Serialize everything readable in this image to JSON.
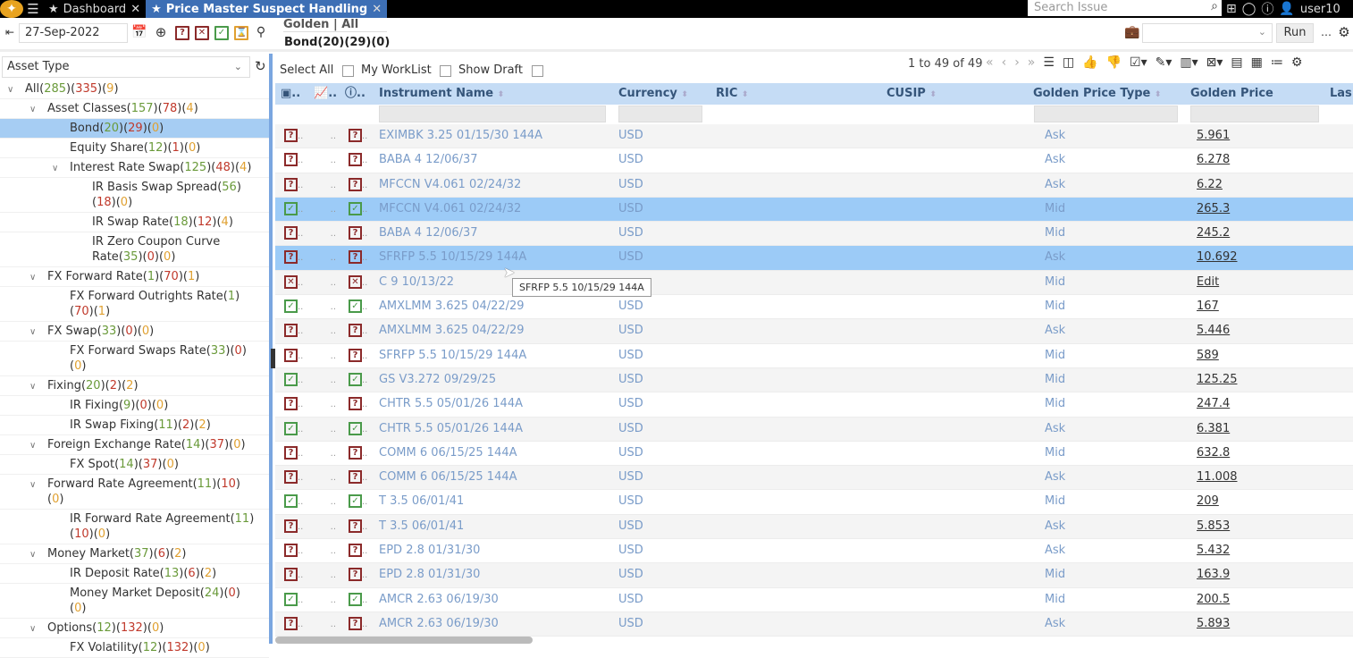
{
  "topbar": {
    "tabs": [
      {
        "label": "Dashboard",
        "active": false
      },
      {
        "label": "Price Master Suspect Handling",
        "active": true
      }
    ],
    "search_placeholder": "Search Issue",
    "user": "user10"
  },
  "toolbar": {
    "date": "27-Sep-2022",
    "breadcrumb": "Golden | All",
    "selection": "Bond(20)(29)(0)",
    "run_label": "Run",
    "run_select": ""
  },
  "left": {
    "asset_type": "Asset Type",
    "tree": [
      {
        "name": "All",
        "c": [
          "285",
          "335",
          "9"
        ],
        "level": 0,
        "expanded": true
      },
      {
        "name": "Asset Classes",
        "c": [
          "157",
          "78",
          "4"
        ],
        "level": 1,
        "expanded": true
      },
      {
        "name": "Bond",
        "c": [
          "20",
          "29",
          "0"
        ],
        "level": 2,
        "selected": true
      },
      {
        "name": "Equity Share",
        "c": [
          "12",
          "1",
          "0"
        ],
        "level": 2
      },
      {
        "name": "Interest Rate Swap",
        "c": [
          "125",
          "48",
          "4"
        ],
        "level": 2,
        "expanded": true
      },
      {
        "name": "IR Basis Swap Spread",
        "c": [
          "56",
          "18",
          "0"
        ],
        "level": 3
      },
      {
        "name": "IR Swap Rate",
        "c": [
          "18",
          "12",
          "4"
        ],
        "level": 3
      },
      {
        "name": "IR Zero Coupon Curve Rate",
        "c": [
          "35",
          "0",
          "0"
        ],
        "level": 3
      },
      {
        "name": "FX Forward Rate",
        "c": [
          "1",
          "70",
          "1"
        ],
        "level": 1,
        "expanded": true
      },
      {
        "name": "FX Forward Outrights Rate",
        "c": [
          "1",
          "70",
          "1"
        ],
        "level": 2
      },
      {
        "name": "FX Swap",
        "c": [
          "33",
          "0",
          "0"
        ],
        "level": 1,
        "expanded": true
      },
      {
        "name": "FX Forward Swaps Rate",
        "c": [
          "33",
          "0",
          "0"
        ],
        "level": 2
      },
      {
        "name": "Fixing",
        "c": [
          "20",
          "2",
          "2"
        ],
        "level": 1,
        "expanded": true
      },
      {
        "name": "IR Fixing",
        "c": [
          "9",
          "0",
          "0"
        ],
        "level": 2
      },
      {
        "name": "IR Swap Fixing",
        "c": [
          "11",
          "2",
          "2"
        ],
        "level": 2
      },
      {
        "name": "Foreign Exchange Rate",
        "c": [
          "14",
          "37",
          "0"
        ],
        "level": 1,
        "expanded": true
      },
      {
        "name": "FX Spot",
        "c": [
          "14",
          "37",
          "0"
        ],
        "level": 2
      },
      {
        "name": "Forward Rate Agreement",
        "c": [
          "11",
          "10",
          "0"
        ],
        "level": 1,
        "expanded": true
      },
      {
        "name": "IR Forward Rate Agreement",
        "c": [
          "11",
          "10",
          "0"
        ],
        "level": 2
      },
      {
        "name": "Money Market",
        "c": [
          "37",
          "6",
          "2"
        ],
        "level": 1,
        "expanded": true
      },
      {
        "name": "IR Deposit Rate",
        "c": [
          "13",
          "6",
          "2"
        ],
        "level": 2
      },
      {
        "name": "Money Market Deposit",
        "c": [
          "24",
          "0",
          "0"
        ],
        "level": 2
      },
      {
        "name": "Options",
        "c": [
          "12",
          "132",
          "0"
        ],
        "level": 1,
        "expanded": true
      },
      {
        "name": "FX Volatility",
        "c": [
          "12",
          "132",
          "0"
        ],
        "level": 2
      }
    ]
  },
  "grid": {
    "select_all": "Select All",
    "my_worklist": "My WorkList",
    "show_draft": "Show Draft",
    "pager": "1 to 49 of 49",
    "columns": [
      "Instrument Name",
      "Currency",
      "RIC",
      "CUSIP",
      "Golden Price Type",
      "Golden Price",
      "Las"
    ],
    "tooltip": "SFRFP 5.5 10/15/29 144A",
    "rows": [
      {
        "s": "q",
        "name": "EXIMBK 3.25 01/15/30 144A",
        "cur": "USD",
        "type": "Ask",
        "price": "5.961"
      },
      {
        "s": "q",
        "name": "BABA 4 12/06/37",
        "cur": "USD",
        "type": "Ask",
        "price": "6.278"
      },
      {
        "s": "q",
        "name": "MFCCN V4.061 02/24/32",
        "cur": "USD",
        "type": "Ask",
        "price": "6.22"
      },
      {
        "s": "c",
        "name": "MFCCN V4.061 02/24/32",
        "cur": "USD",
        "type": "Mid",
        "price": "265.3",
        "hl": true
      },
      {
        "s": "q",
        "name": "BABA 4 12/06/37",
        "cur": "USD",
        "type": "Mid",
        "price": "245.2"
      },
      {
        "s": "q",
        "name": "SFRFP 5.5 10/15/29 144A",
        "cur": "USD",
        "type": "Ask",
        "price": "10.692",
        "hl": true
      },
      {
        "s": "x",
        "name": "C 9 10/13/22",
        "cur": "",
        "type": "Mid",
        "price": "Edit"
      },
      {
        "s": "c",
        "name": "AMXLMM 3.625 04/22/29",
        "cur": "USD",
        "type": "Mid",
        "price": "167"
      },
      {
        "s": "q",
        "name": "AMXLMM 3.625 04/22/29",
        "cur": "USD",
        "type": "Ask",
        "price": "5.446"
      },
      {
        "s": "q",
        "name": "SFRFP 5.5 10/15/29 144A",
        "cur": "USD",
        "type": "Mid",
        "price": "589"
      },
      {
        "s": "c",
        "name": "GS V3.272 09/29/25",
        "cur": "USD",
        "type": "Mid",
        "price": "125.25"
      },
      {
        "s": "q",
        "name": "CHTR 5.5 05/01/26 144A",
        "cur": "USD",
        "type": "Mid",
        "price": "247.4"
      },
      {
        "s": "c",
        "name": "CHTR 5.5 05/01/26 144A",
        "cur": "USD",
        "type": "Ask",
        "price": "6.381"
      },
      {
        "s": "q",
        "name": "COMM 6 06/15/25 144A",
        "cur": "USD",
        "type": "Mid",
        "price": "632.8"
      },
      {
        "s": "q",
        "name": "COMM 6 06/15/25 144A",
        "cur": "USD",
        "type": "Ask",
        "price": "11.008"
      },
      {
        "s": "c",
        "name": "T 3.5 06/01/41",
        "cur": "USD",
        "type": "Mid",
        "price": "209"
      },
      {
        "s": "q",
        "name": "T 3.5 06/01/41",
        "cur": "USD",
        "type": "Ask",
        "price": "5.853"
      },
      {
        "s": "q",
        "name": "EPD 2.8 01/31/30",
        "cur": "USD",
        "type": "Ask",
        "price": "5.432"
      },
      {
        "s": "q",
        "name": "EPD 2.8 01/31/30",
        "cur": "USD",
        "type": "Mid",
        "price": "163.9"
      },
      {
        "s": "c",
        "name": "AMCR 2.63 06/19/30",
        "cur": "USD",
        "type": "Mid",
        "price": "200.5"
      },
      {
        "s": "q",
        "name": "AMCR 2.63 06/19/30",
        "cur": "USD",
        "type": "Ask",
        "price": "5.893"
      }
    ]
  },
  "colors": {
    "accent": "#3d6fb5",
    "header": "#c5dcf5",
    "highlight": "#9ccbf7",
    "green": "#6a9a3a",
    "red": "#c0392b",
    "orange": "#e0a030"
  }
}
